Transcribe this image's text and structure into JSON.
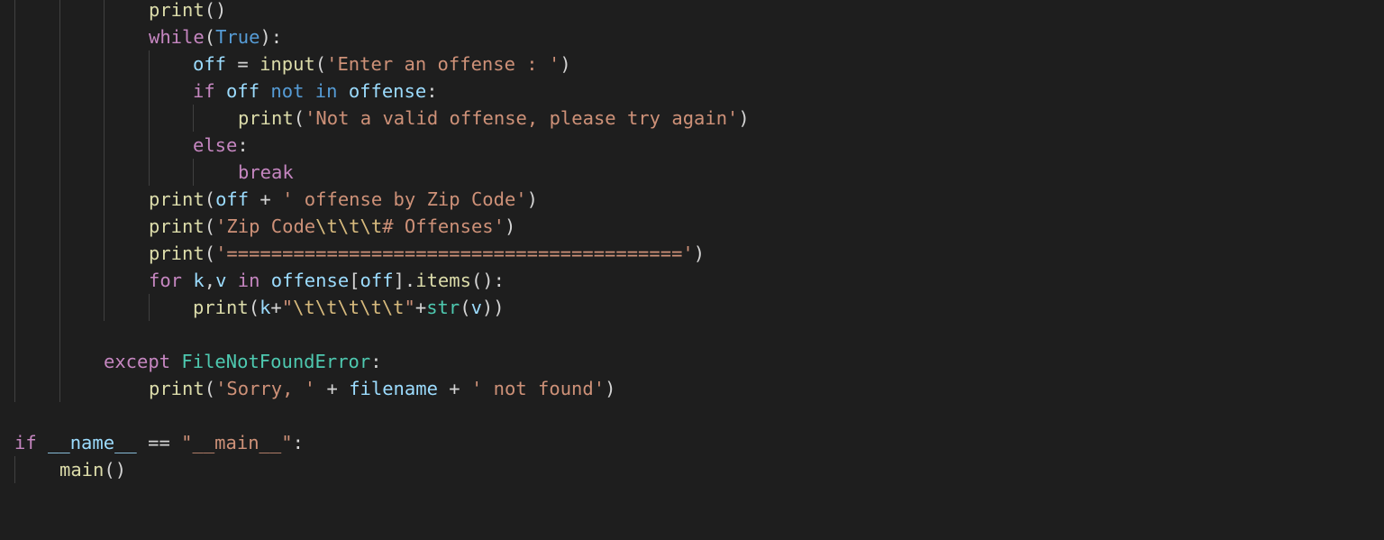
{
  "editor": {
    "language": "python",
    "theme_colors": {
      "background": "#1e1e1e",
      "default_text": "#d4d4d4",
      "keyword_control": "#c586c0",
      "keyword_storage": "#569cd6",
      "function": "#dcdcaa",
      "variable": "#9cdcfe",
      "string": "#ce9178",
      "escape": "#d7ba7d",
      "class": "#4ec9b0",
      "indent_guide": "#404040"
    },
    "lines": [
      {
        "tokens": [
          {
            "c": "fn",
            "t": "print"
          },
          {
            "c": "op",
            "t": "()"
          }
        ]
      },
      {
        "tokens": [
          {
            "c": "kw",
            "t": "while"
          },
          {
            "c": "op",
            "t": "("
          },
          {
            "c": "kwb",
            "t": "True"
          },
          {
            "c": "op",
            "t": "):"
          }
        ]
      },
      {
        "tokens": [
          {
            "c": "var",
            "t": "off"
          },
          {
            "c": "op",
            "t": " = "
          },
          {
            "c": "fn",
            "t": "input"
          },
          {
            "c": "op",
            "t": "("
          },
          {
            "c": "str",
            "t": "'Enter an offense : '"
          },
          {
            "c": "op",
            "t": ")"
          }
        ]
      },
      {
        "tokens": [
          {
            "c": "kw",
            "t": "if"
          },
          {
            "c": "op",
            "t": " "
          },
          {
            "c": "var",
            "t": "off"
          },
          {
            "c": "op",
            "t": " "
          },
          {
            "c": "kwb",
            "t": "not"
          },
          {
            "c": "op",
            "t": " "
          },
          {
            "c": "kwb",
            "t": "in"
          },
          {
            "c": "op",
            "t": " "
          },
          {
            "c": "var",
            "t": "offense"
          },
          {
            "c": "op",
            "t": ":"
          }
        ]
      },
      {
        "tokens": [
          {
            "c": "fn",
            "t": "print"
          },
          {
            "c": "op",
            "t": "("
          },
          {
            "c": "str",
            "t": "'Not a valid offense, please try again'"
          },
          {
            "c": "op",
            "t": ")"
          }
        ]
      },
      {
        "tokens": [
          {
            "c": "kw",
            "t": "else"
          },
          {
            "c": "op",
            "t": ":"
          }
        ]
      },
      {
        "tokens": [
          {
            "c": "kw",
            "t": "break"
          }
        ]
      },
      {
        "tokens": [
          {
            "c": "fn",
            "t": "print"
          },
          {
            "c": "op",
            "t": "("
          },
          {
            "c": "var",
            "t": "off"
          },
          {
            "c": "op",
            "t": " + "
          },
          {
            "c": "str",
            "t": "' offense by Zip Code'"
          },
          {
            "c": "op",
            "t": ")"
          }
        ]
      },
      {
        "tokens": [
          {
            "c": "fn",
            "t": "print"
          },
          {
            "c": "op",
            "t": "("
          },
          {
            "c": "str",
            "t": "'Zip Code"
          },
          {
            "c": "esc",
            "t": "\\t\\t\\t"
          },
          {
            "c": "str",
            "t": "# Offenses'"
          },
          {
            "c": "op",
            "t": ")"
          }
        ]
      },
      {
        "tokens": [
          {
            "c": "fn",
            "t": "print"
          },
          {
            "c": "op",
            "t": "("
          },
          {
            "c": "str",
            "t": "'========================================='"
          },
          {
            "c": "op",
            "t": ")"
          }
        ]
      },
      {
        "tokens": [
          {
            "c": "kw",
            "t": "for"
          },
          {
            "c": "op",
            "t": " "
          },
          {
            "c": "var",
            "t": "k"
          },
          {
            "c": "op",
            "t": ","
          },
          {
            "c": "var",
            "t": "v"
          },
          {
            "c": "op",
            "t": " "
          },
          {
            "c": "kw",
            "t": "in"
          },
          {
            "c": "op",
            "t": " "
          },
          {
            "c": "var",
            "t": "offense"
          },
          {
            "c": "op",
            "t": "["
          },
          {
            "c": "var",
            "t": "off"
          },
          {
            "c": "op",
            "t": "]."
          },
          {
            "c": "fn",
            "t": "items"
          },
          {
            "c": "op",
            "t": "():"
          }
        ]
      },
      {
        "tokens": [
          {
            "c": "fn",
            "t": "print"
          },
          {
            "c": "op",
            "t": "("
          },
          {
            "c": "var",
            "t": "k"
          },
          {
            "c": "op",
            "t": "+"
          },
          {
            "c": "str",
            "t": "\""
          },
          {
            "c": "esc",
            "t": "\\t\\t\\t\\t\\t"
          },
          {
            "c": "str",
            "t": "\""
          },
          {
            "c": "op",
            "t": "+"
          },
          {
            "c": "cls",
            "t": "str"
          },
          {
            "c": "op",
            "t": "("
          },
          {
            "c": "var",
            "t": "v"
          },
          {
            "c": "op",
            "t": "))"
          }
        ]
      },
      {
        "tokens": []
      },
      {
        "tokens": [
          {
            "c": "kw",
            "t": "except"
          },
          {
            "c": "op",
            "t": " "
          },
          {
            "c": "cls",
            "t": "FileNotFoundError"
          },
          {
            "c": "op",
            "t": ":"
          }
        ]
      },
      {
        "tokens": [
          {
            "c": "fn",
            "t": "print"
          },
          {
            "c": "op",
            "t": "("
          },
          {
            "c": "str",
            "t": "'Sorry, '"
          },
          {
            "c": "op",
            "t": " + "
          },
          {
            "c": "var",
            "t": "filename"
          },
          {
            "c": "op",
            "t": " + "
          },
          {
            "c": "str",
            "t": "' not found'"
          },
          {
            "c": "op",
            "t": ")"
          }
        ]
      },
      {
        "tokens": []
      },
      {
        "tokens": [
          {
            "c": "kw",
            "t": "if"
          },
          {
            "c": "op",
            "t": " "
          },
          {
            "c": "var",
            "t": "__name__"
          },
          {
            "c": "op",
            "t": " == "
          },
          {
            "c": "str",
            "t": "\"__main__\""
          },
          {
            "c": "op",
            "t": ":"
          }
        ]
      },
      {
        "tokens": [
          {
            "c": "fn",
            "t": "main"
          },
          {
            "c": "op",
            "t": "()"
          }
        ]
      }
    ]
  }
}
